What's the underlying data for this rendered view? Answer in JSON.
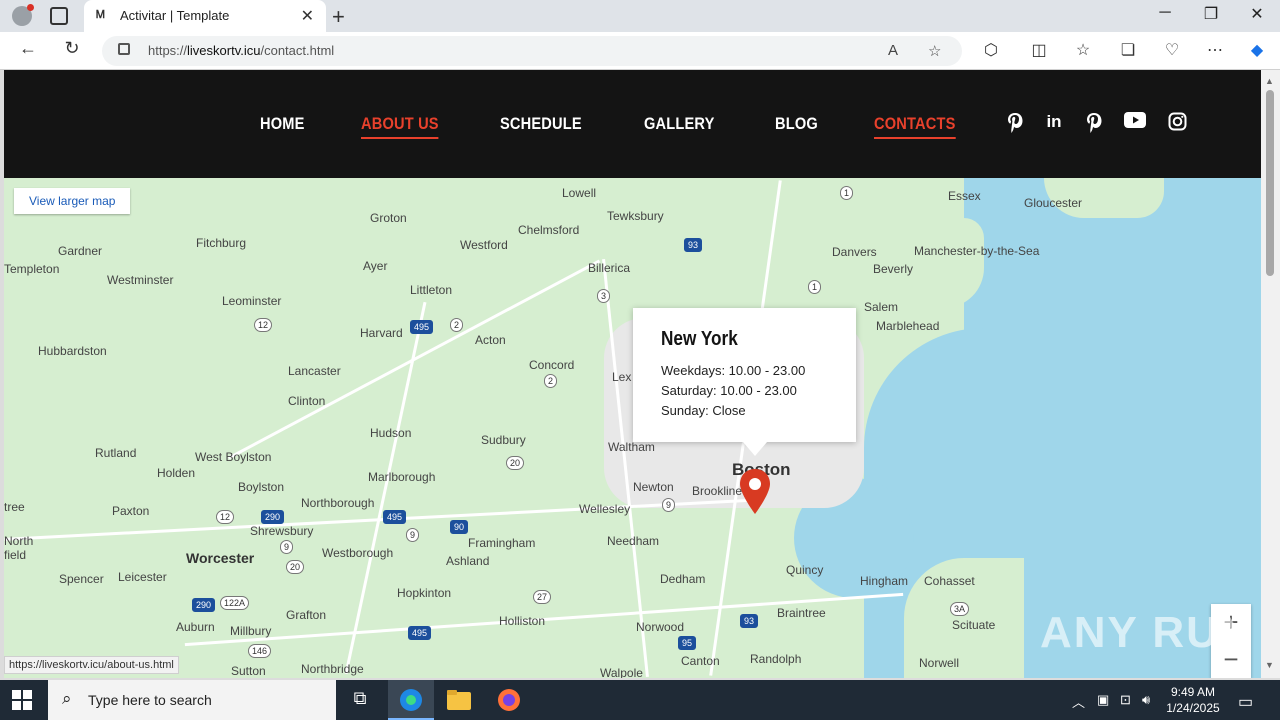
{
  "browser": {
    "tab_title": "Activitar | Template",
    "tab_favicon": "Ꮇ",
    "url_prefix": "https://",
    "url_host": "liveskortv.icu",
    "url_path": "/contact.html"
  },
  "nav": {
    "items": [
      {
        "label": "HOME",
        "active": false
      },
      {
        "label": "ABOUT US",
        "active": true
      },
      {
        "label": "SCHEDULE",
        "active": false
      },
      {
        "label": "GALLERY",
        "active": false
      },
      {
        "label": "BLOG",
        "active": false
      },
      {
        "label": "CONTACTS",
        "active": true
      }
    ],
    "social_icons": [
      "pinterest-icon",
      "linkedin-icon",
      "pinterest-icon",
      "youtube-icon",
      "instagram-icon"
    ],
    "accent_color": "#e8412c"
  },
  "map": {
    "larger_map_link": "View larger map",
    "info_title": "New York",
    "info_lines": [
      "Weekdays: 10.00 - 23.00",
      "Saturday: 10.00 - 23.00",
      "Sunday: Close"
    ],
    "zoom_in": "+",
    "zoom_out": "−",
    "labels": {
      "l1": "Lowell",
      "l2": "Tewksbury",
      "l3": "Groton",
      "l4": "Chelmsford",
      "l5": "Westford",
      "l6": "Billerica",
      "l7": "Fitchburg",
      "l8": "Gardner",
      "l9": "Ayer",
      "l10": "Westminster",
      "l11": "Leominster",
      "l12": "Templeton",
      "l13": "Harvard",
      "l14": "Littleton",
      "l15": "Acton",
      "l16": "Concord",
      "l17": "Lancaster",
      "l18": "Hubbardston",
      "l19": "Clinton",
      "l20": "Hudson",
      "l21": "Sudbury",
      "l22": "Rutland",
      "l23": "West Boylston",
      "l24": "Holden",
      "l25": "Boylston",
      "l26": "Marlborough",
      "l27": "Waltham",
      "l28": "Boston",
      "l29": "Newton",
      "l30": "Brookline",
      "l31": "Paxton",
      "l32": "Northborough",
      "l33": "Shrewsbury",
      "l34": "Framingham",
      "l35": "Wellesley",
      "l36": "Needham",
      "l37": "Worcester",
      "l38": "Westborough",
      "l39": "Ashland",
      "l40": "Leicester",
      "l41": "Spencer",
      "l42": "Hopkinton",
      "l43": "Dedham",
      "l44": "Quincy",
      "l45": "Hingham",
      "l46": "Cohasset",
      "l47": "Grafton",
      "l48": "Millbury",
      "l49": "Auburn",
      "l50": "Holliston",
      "l51": "Norwood",
      "l52": "Braintree",
      "l53": "Scituate",
      "l54": "Canton",
      "l55": "Randolph",
      "l56": "Northbridge",
      "l57": "Sutton",
      "l58": "Walpole",
      "l59": "Norwell",
      "l60": "Essex",
      "l61": "Gloucester",
      "l62": "Danvers",
      "l63": "Manchester-by-the-Sea",
      "l64": "Beverly",
      "l65": "Salem",
      "l66": "Marblehead",
      "l67": "North",
      "l68": "field",
      "l69": "tree",
      "l70": "Lex"
    },
    "shields": [
      "93",
      "3",
      "1",
      "495",
      "2",
      "12",
      "2",
      "20",
      "290",
      "495",
      "9",
      "90",
      "9",
      "12",
      "9",
      "20",
      "290",
      "122A",
      "146",
      "495",
      "27",
      "95",
      "93",
      "3A",
      "1"
    ]
  },
  "status_url": "https://liveskortv.icu/about-us.html",
  "watermark": "ANY RUN",
  "taskbar": {
    "search_placeholder": "Type here to search",
    "time": "9:49 AM",
    "date": "1/24/2025"
  }
}
